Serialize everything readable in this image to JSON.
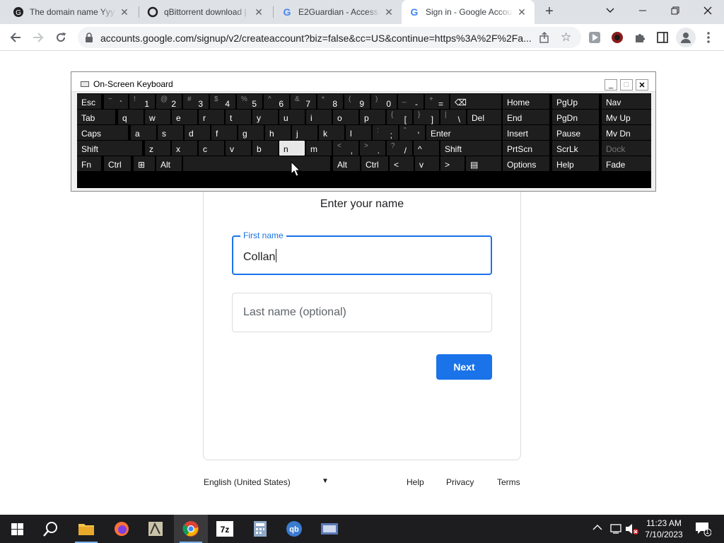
{
  "browser": {
    "tabs": [
      {
        "title": "The domain name Yyyy",
        "favicon": "site-icon",
        "active": false
      },
      {
        "title": "qBittorrent download |",
        "favicon": "site-icon",
        "active": false
      },
      {
        "title": "E2Guardian - Access De",
        "favicon": "google-icon",
        "active": false
      },
      {
        "title": "Sign in - Google Accou",
        "favicon": "google-icon",
        "active": true
      }
    ],
    "new_tab": "+",
    "url": "accounts.google.com/signup/v2/createaccount?biz=false&cc=US&continue=https%3A%2F%2Fa..."
  },
  "signup": {
    "heading": "Enter your name",
    "first_name_label": "First name",
    "first_name_value": "Collan",
    "last_name_placeholder": "Last name (optional)",
    "next_label": "Next"
  },
  "footer": {
    "language": "English (United States)",
    "help": "Help",
    "privacy": "Privacy",
    "terms": "Terms"
  },
  "osk": {
    "title": "On-Screen Keyboard",
    "rows": [
      [
        {
          "k": "Esc"
        },
        {
          "s": "~",
          "k": "`"
        },
        {
          "s": "!",
          "k": "1"
        },
        {
          "s": "@",
          "k": "2"
        },
        {
          "s": "#",
          "k": "3"
        },
        {
          "s": "$",
          "k": "4"
        },
        {
          "s": "%",
          "k": "5"
        },
        {
          "s": "^",
          "k": "6"
        },
        {
          "s": "&",
          "k": "7"
        },
        {
          "s": "*",
          "k": "8"
        },
        {
          "s": "(",
          "k": "9"
        },
        {
          "s": ")",
          "k": "0"
        },
        {
          "s": "_",
          "k": "-"
        },
        {
          "s": "+",
          "k": "="
        },
        {
          "k": "⌫"
        }
      ],
      [
        {
          "k": "Tab"
        },
        {
          "k": "q"
        },
        {
          "k": "w"
        },
        {
          "k": "e"
        },
        {
          "k": "r"
        },
        {
          "k": "t"
        },
        {
          "k": "y"
        },
        {
          "k": "u"
        },
        {
          "k": "i"
        },
        {
          "k": "o"
        },
        {
          "k": "p"
        },
        {
          "s": "{",
          "k": "["
        },
        {
          "s": "}",
          "k": "]"
        },
        {
          "s": "|",
          "k": "\\"
        },
        {
          "k": "Del"
        }
      ],
      [
        {
          "k": "Caps"
        },
        {
          "k": "a"
        },
        {
          "k": "s"
        },
        {
          "k": "d"
        },
        {
          "k": "f"
        },
        {
          "k": "g"
        },
        {
          "k": "h"
        },
        {
          "k": "j"
        },
        {
          "k": "k"
        },
        {
          "k": "l"
        },
        {
          "s": ":",
          "k": ";"
        },
        {
          "s": "\"",
          "k": "'"
        },
        {
          "k": "Enter"
        }
      ],
      [
        {
          "k": "Shift"
        },
        {
          "k": "z"
        },
        {
          "k": "x"
        },
        {
          "k": "c"
        },
        {
          "k": "v"
        },
        {
          "k": "b"
        },
        {
          "k": "n"
        },
        {
          "k": "m"
        },
        {
          "s": "<",
          "k": ","
        },
        {
          "s": ">",
          "k": "."
        },
        {
          "s": "?",
          "k": "/"
        },
        {
          "k": "^"
        },
        {
          "k": "Shift"
        }
      ],
      [
        {
          "k": "Fn"
        },
        {
          "k": "Ctrl"
        },
        {
          "k": "⊞"
        },
        {
          "k": "Alt"
        },
        {
          "k": ""
        },
        {
          "k": "Alt"
        },
        {
          "k": "Ctrl"
        },
        {
          "k": "<"
        },
        {
          "k": "v"
        },
        {
          "k": ">"
        },
        {
          "k": "▤"
        }
      ]
    ],
    "nav": [
      [
        "Home",
        "PgUp",
        "Nav"
      ],
      [
        "End",
        "PgDn",
        "Mv Up"
      ],
      [
        "Insert",
        "Pause",
        "Mv Dn"
      ],
      [
        "PrtScn",
        "ScrLk",
        "Dock"
      ],
      [
        "Options",
        "Help",
        "Fade"
      ]
    ]
  },
  "taskbar": {
    "time": "11:23 AM",
    "date": "7/10/2023",
    "notification_count": "1"
  }
}
